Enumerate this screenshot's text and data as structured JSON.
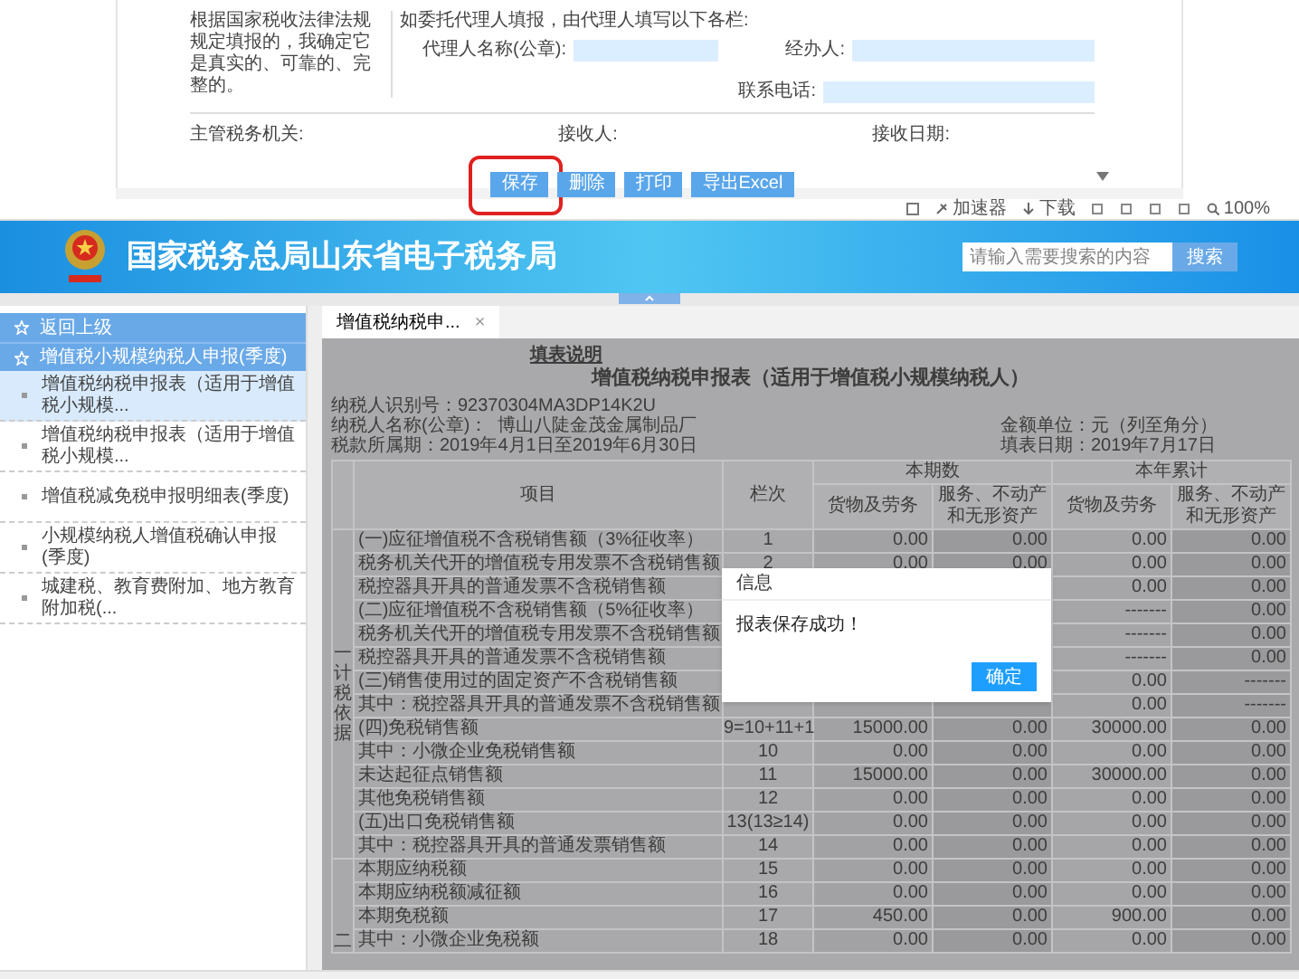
{
  "declaration_form": {
    "statement": "根据国家税收法律法规规定填报的，我确定它是真实的、可靠的、完整的。",
    "agent_heading": "如委托代理人填报，由代理人填写以下各栏:",
    "fields": [
      {
        "label": "代理人名称(公章):"
      },
      {
        "label": "经办人:"
      },
      {
        "label": "联系电话:"
      }
    ],
    "receipt_labels": [
      "主管税务机关:",
      "接收人:",
      "接收日期:"
    ],
    "buttons": [
      {
        "label": "保存",
        "highlighted": true
      },
      {
        "label": "删除",
        "highlighted": false
      },
      {
        "label": "打印",
        "highlighted": false
      },
      {
        "label": "导出Excel",
        "highlighted": false
      }
    ]
  },
  "browser_toolbar": [
    {
      "label": "加速器"
    },
    {
      "label": "下载"
    },
    {
      "label": "100%"
    }
  ],
  "header": {
    "title": "国家税务总局山东省电子税务局",
    "search": {
      "placeholder": "请输入需要搜索的内容"
    },
    "search_button": "搜索"
  },
  "sidebar": {
    "back": "返回上级",
    "section": "增值税小规模纳税人申报(季度)",
    "items": [
      {
        "label": "增值税纳税申报表（适用于增值税小规模...",
        "selected": true
      },
      {
        "label": "增值税纳税申报表（适用于增值税小规模...",
        "selected": false
      },
      {
        "label": "增值税减免税申报明细表(季度)",
        "selected": false
      },
      {
        "label": "小规模纳税人增值税确认申报(季度)",
        "selected": false
      },
      {
        "label": "城建税、教育费附加、地方教育附加税(...",
        "selected": false
      }
    ]
  },
  "tabs": [
    {
      "label": "增值税纳税申...",
      "close": "×",
      "selected": true
    }
  ],
  "report": {
    "instructions_link": "填表说明",
    "title": "增值税纳税申报表（适用于增值税小规模纳税人）",
    "info_rows": [
      {
        "left": "纳税人识别号：92370304MA3DP14K2U"
      },
      {
        "left": "纳税人名称(公章)：  博山八陡金茂金属制品厂",
        "right": "金额单位：元（列至角分）"
      },
      {
        "left": "税款所属期：2019年4月1日至2019年6月30日",
        "right": "填表日期：2019年7月17日"
      }
    ],
    "columns": {
      "item": "项目",
      "line": "栏次",
      "groups": [
        {
          "label": "本期数",
          "subs": [
            "货物及劳务",
            "服务、不动产和无形资产"
          ]
        },
        {
          "label": "本年累计",
          "subs": [
            "货物及劳务",
            "服务、不动产和无形资产"
          ]
        }
      ]
    },
    "sections": [
      {
        "label": "一计税依据",
        "rows": [
          {
            "item": "(一)应征增值税不含税销售额（3%征收率）",
            "line": "1",
            "cells": [
              "0.00",
              "0.00",
              "0.00",
              "0.00"
            ]
          },
          {
            "item": "税务机关代开的增值税专用发票不含税销售额",
            "line": "2",
            "cells": [
              "0.00",
              "0.00",
              "0.00",
              "0.00"
            ]
          },
          {
            "item": "税控器具开具的普通发票不含税销售额",
            "line": null,
            "cells": [
              null,
              null,
              "0.00",
              "0.00"
            ]
          },
          {
            "item": "(二)应征增值税不含税销售额（5%征收率）",
            "line": null,
            "cells": [
              null,
              null,
              "-------",
              "0.00"
            ]
          },
          {
            "item": "税务机关代开的增值税专用发票不含税销售额",
            "line": null,
            "cells": [
              null,
              null,
              "-------",
              "0.00"
            ]
          },
          {
            "item": "税控器具开具的普通发票不含税销售额",
            "line": null,
            "cells": [
              null,
              null,
              "-------",
              "0.00"
            ]
          },
          {
            "item": "(三)销售使用过的固定资产不含税销售额",
            "line": null,
            "cells": [
              null,
              null,
              "0.00",
              "-------"
            ]
          },
          {
            "item": "其中：税控器具开具的普通发票不含税销售额",
            "line": null,
            "cells": [
              null,
              null,
              "0.00",
              "-------"
            ]
          },
          {
            "item": "(四)免税销售额",
            "line": "9=10+11+1",
            "cells": [
              "15000.00",
              "0.00",
              "30000.00",
              "0.00"
            ]
          },
          {
            "item": "其中：小微企业免税销售额",
            "line": "10",
            "cells": [
              "0.00",
              "0.00",
              "0.00",
              "0.00"
            ]
          },
          {
            "item": "未达起征点销售额",
            "line": "11",
            "cells": [
              "15000.00",
              "0.00",
              "30000.00",
              "0.00"
            ]
          },
          {
            "item": "其他免税销售额",
            "line": "12",
            "cells": [
              "0.00",
              "0.00",
              "0.00",
              "0.00"
            ]
          },
          {
            "item": "(五)出口免税销售额",
            "line": "13(13≥14)",
            "cells": [
              "0.00",
              "0.00",
              "0.00",
              "0.00"
            ]
          },
          {
            "item": "其中：税控器具开具的普通发票销售额",
            "line": "14",
            "cells": [
              "0.00",
              "0.00",
              "0.00",
              "0.00"
            ]
          }
        ]
      },
      {
        "label": "二",
        "rows": [
          {
            "item": "本期应纳税额",
            "line": "15",
            "cells": [
              "0.00",
              "0.00",
              "0.00",
              "0.00"
            ]
          },
          {
            "item": "本期应纳税额减征额",
            "line": "16",
            "cells": [
              "0.00",
              "0.00",
              "0.00",
              "0.00"
            ]
          },
          {
            "item": "本期免税额",
            "line": "17",
            "cells": [
              "450.00",
              "0.00",
              "900.00",
              "0.00"
            ]
          },
          {
            "item": "其中：小微企业免税额",
            "line": "18",
            "cells": [
              "0.00",
              "0.00",
              "0.00",
              "0.00"
            ]
          }
        ]
      }
    ]
  },
  "dialog": {
    "title": "信息",
    "message": "报表保存成功！",
    "button": "确定"
  }
}
